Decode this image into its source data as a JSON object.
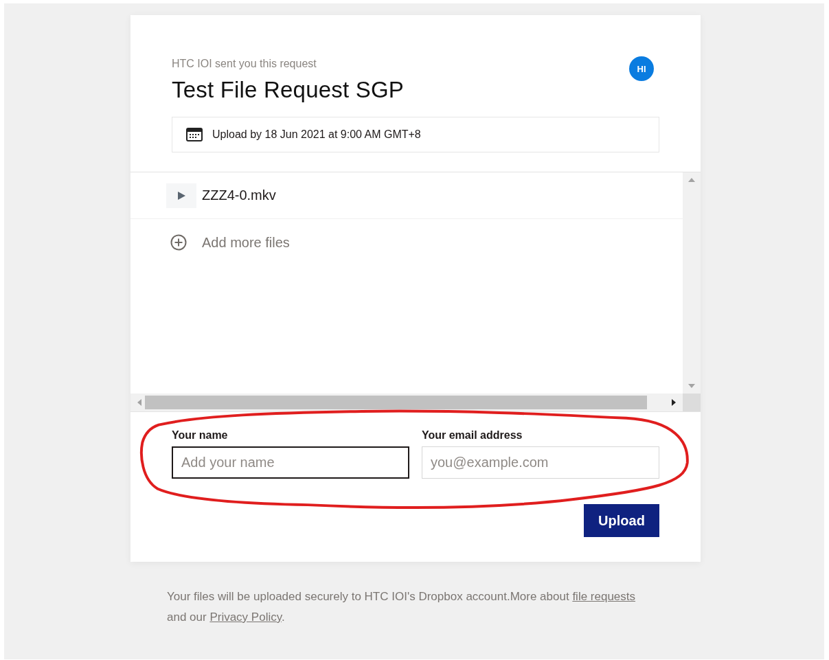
{
  "request": {
    "sender_line": "HTC IOI sent you this request",
    "title": "Test File Request SGP",
    "avatar_initials": "HI",
    "deadline": "Upload by 18 Jun 2021 at 9:00 AM GMT+8"
  },
  "files": [
    {
      "name": "ZZZ4-0.mkv"
    }
  ],
  "add_files": "Add more files",
  "form": {
    "fields": [
      {
        "label": "Your name",
        "placeholder": "Add your name",
        "focused": true
      },
      {
        "label": "Your email address",
        "placeholder": "you@example.com",
        "focused": false
      }
    ],
    "submit": "Upload"
  },
  "footer": {
    "text_before": "Your files will be uploaded securely to HTC IOI's Dropbox account.More about ",
    "link_1": "file requests",
    "text_middle": " and our ",
    "link_2": "Privacy Policy",
    "text_after": "."
  }
}
